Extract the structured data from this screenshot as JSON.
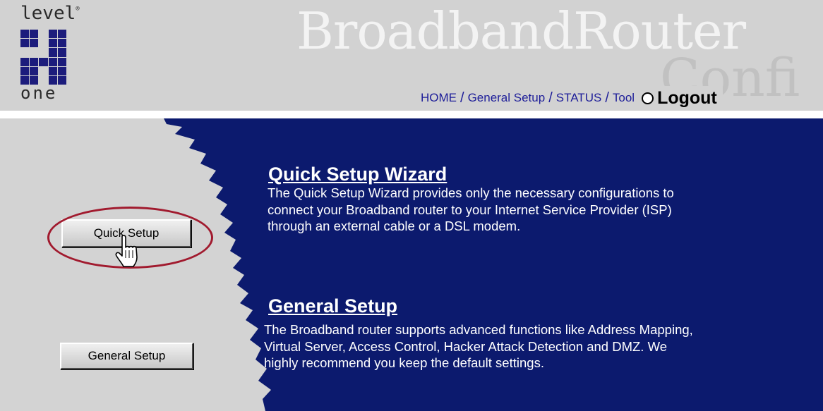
{
  "logo": {
    "top_text": "level",
    "top_mark": "®",
    "bottom_text": "one"
  },
  "brand": {
    "title": "BroadbandRouter",
    "subtitle": "Confi"
  },
  "nav": {
    "home": "HOME",
    "general_setup": "General Setup",
    "status": "STATUS",
    "tool": "Tool",
    "separator": "/",
    "logout": "Logout"
  },
  "buttons": {
    "quick_setup": "Quick Setup",
    "general_setup": "General Setup"
  },
  "sections": {
    "quick": {
      "title": "Quick Setup Wizard",
      "lines": [
        "The Quick Setup Wizard provides only the necessary configurations to",
        "connect your Broadband router to your Internet Service Provider (ISP)",
        "through an external cable or a DSL modem."
      ]
    },
    "general": {
      "title": "General Setup",
      "lines": [
        "The Broadband router supports advanced functions like Address Mapping,",
        "Virtual Server, Access Control, Hacker Attack Detection and DMZ. We",
        "highly recommend you keep the default settings."
      ]
    }
  },
  "colors": {
    "header_bg": "#d2d2d2",
    "panel_blue": "#0c1a6e",
    "nav_link": "#1e1e99",
    "highlight": "#a11a2e"
  }
}
